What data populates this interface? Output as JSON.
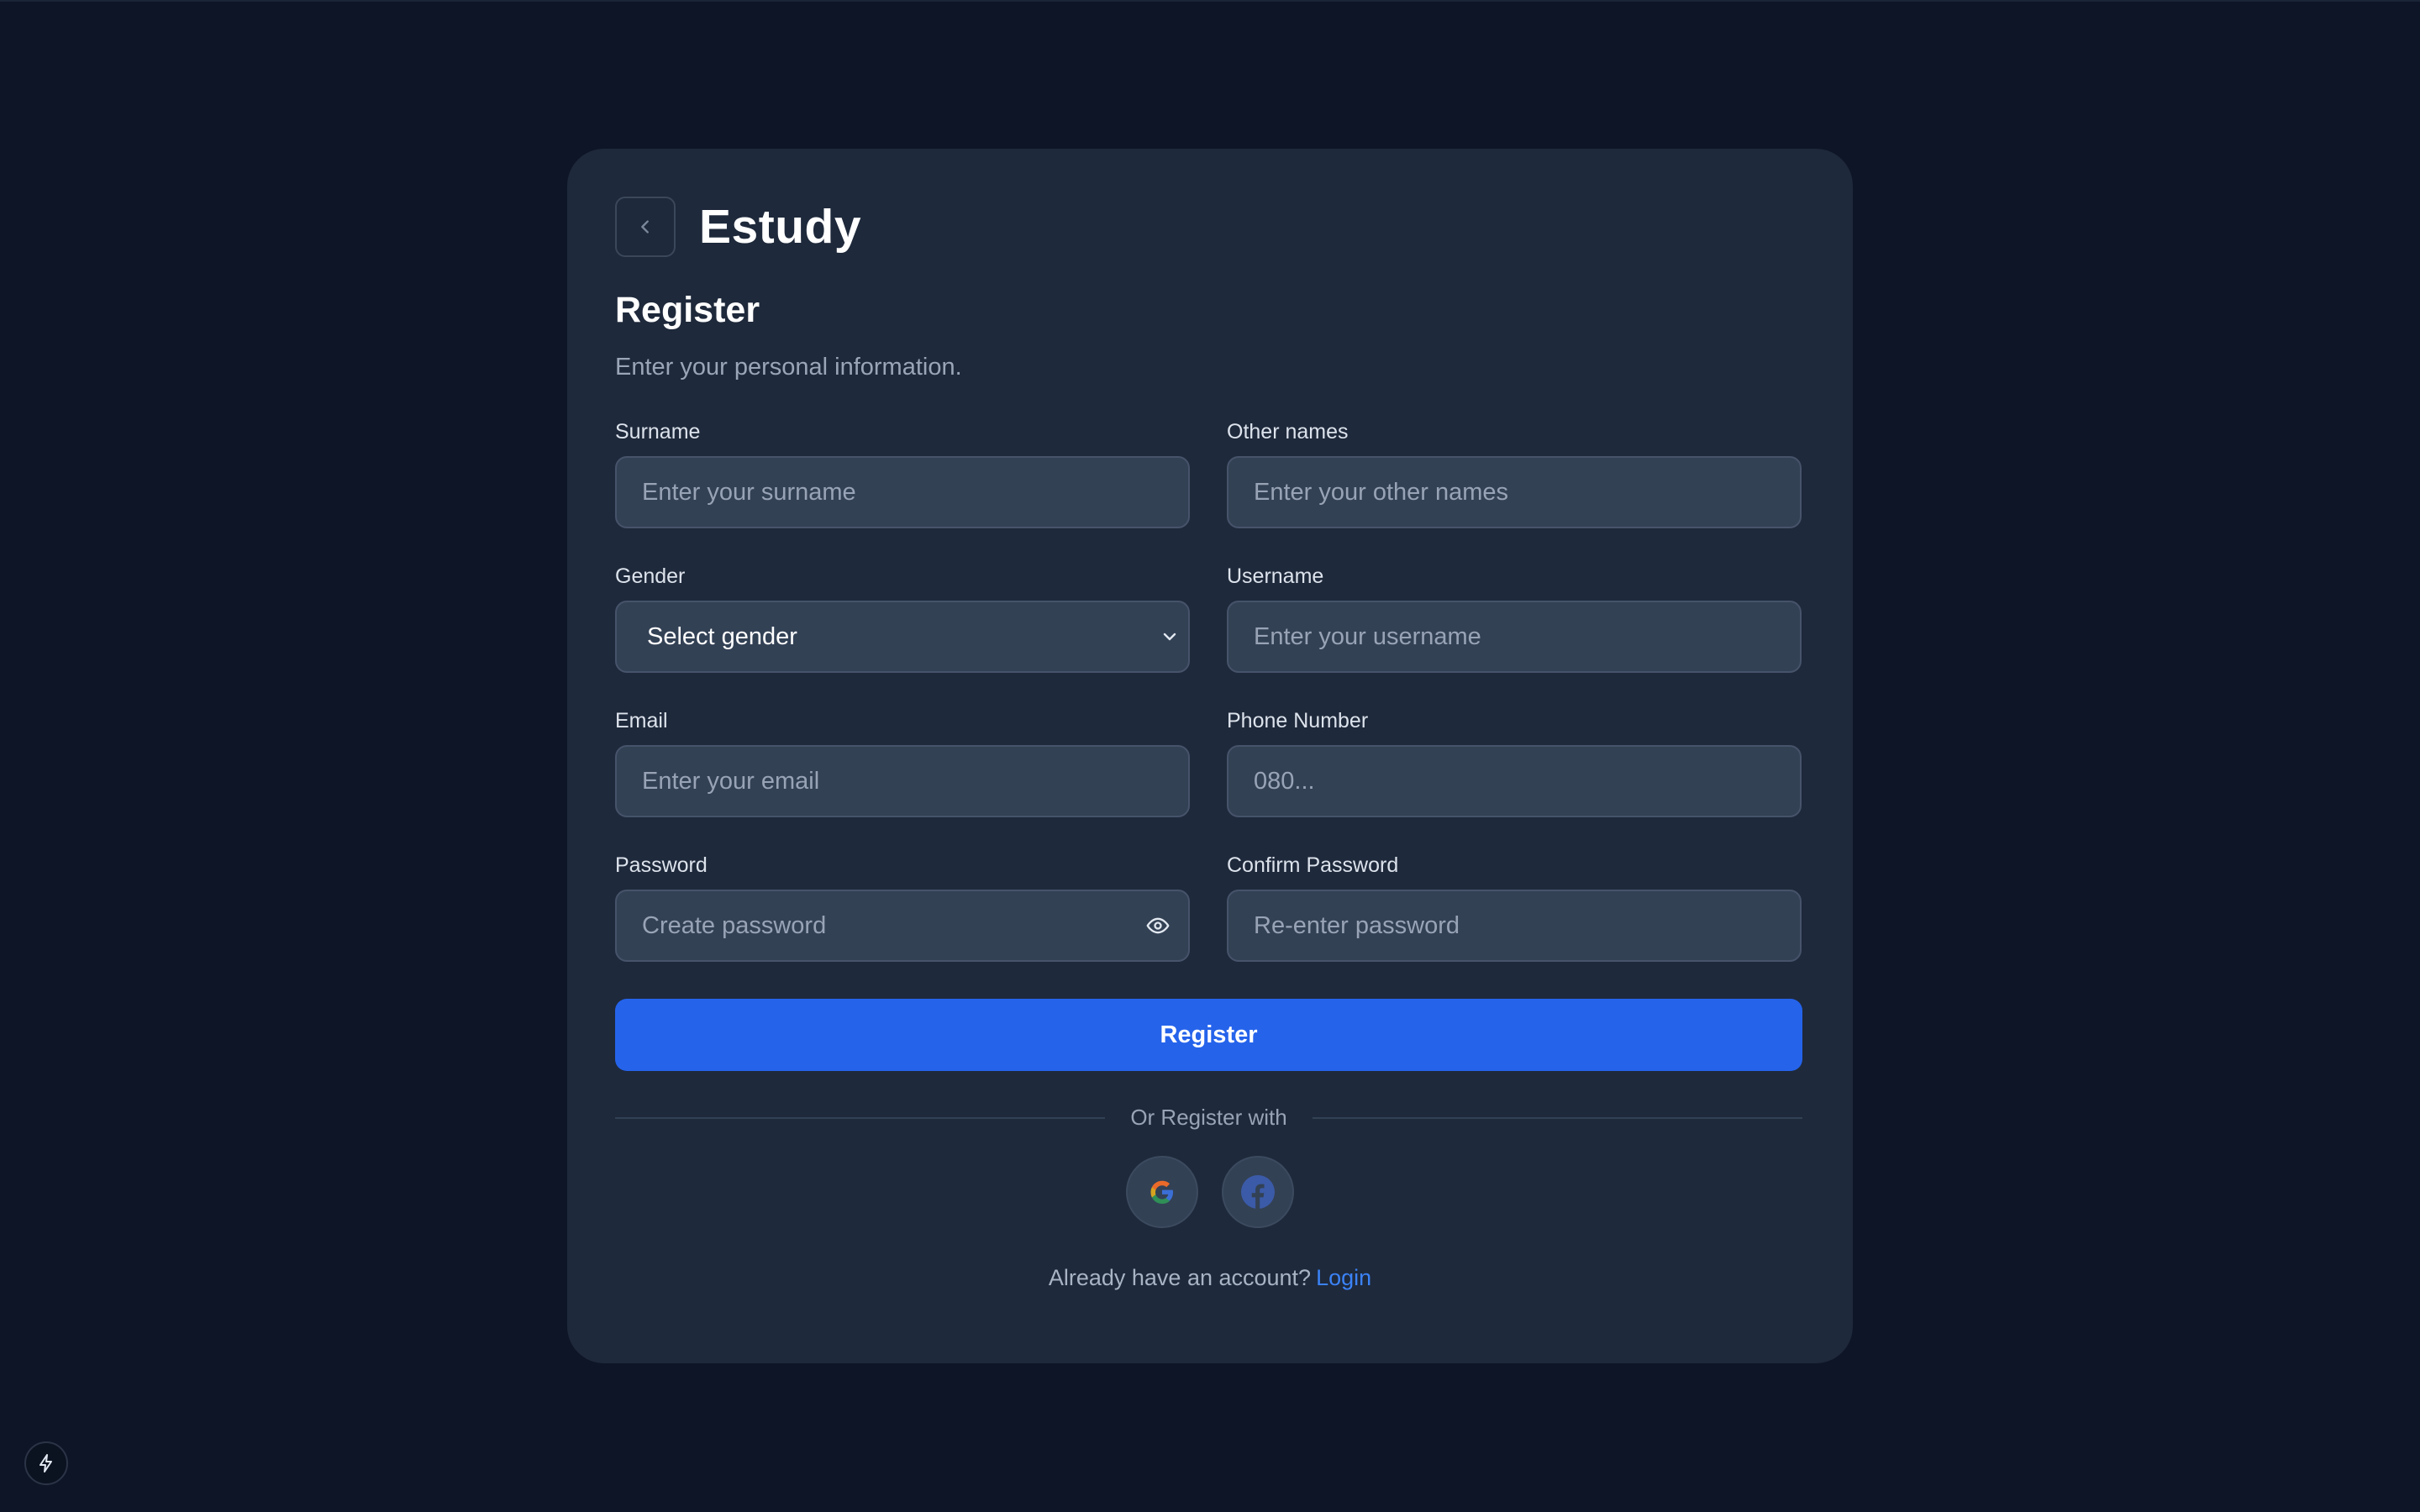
{
  "app": {
    "brand": "Estudy"
  },
  "page": {
    "title": "Register",
    "subtitle": "Enter your personal information."
  },
  "form": {
    "surname": {
      "label": "Surname",
      "placeholder": "Enter your surname",
      "value": ""
    },
    "other_names": {
      "label": "Other names",
      "placeholder": "Enter your other names",
      "value": ""
    },
    "gender": {
      "label": "Gender",
      "selected": "Select gender"
    },
    "username": {
      "label": "Username",
      "placeholder": "Enter your username",
      "value": ""
    },
    "email": {
      "label": "Email",
      "placeholder": "Enter your email",
      "value": ""
    },
    "phone": {
      "label": "Phone Number",
      "placeholder": "080...",
      "value": ""
    },
    "password": {
      "label": "Password",
      "placeholder": "Create password",
      "value": ""
    },
    "confirm_password": {
      "label": "Confirm Password",
      "placeholder": "Re-enter password",
      "value": ""
    },
    "submit_label": "Register"
  },
  "social": {
    "divider_text": "Or Register with",
    "providers": [
      {
        "name": "google",
        "icon": "google-icon"
      },
      {
        "name": "facebook",
        "icon": "facebook-icon"
      }
    ]
  },
  "footer": {
    "prompt": "Already have an account?",
    "login_label": "Login"
  },
  "icons": {
    "back": "chevron-left-icon",
    "password_toggle": "eye-icon",
    "select": "chevron-down-icon",
    "dev_indicator": "lightning-bolt-icon"
  },
  "colors": {
    "background": "#0d1526",
    "card": "#1e293b",
    "input": "#334155",
    "accent": "#2563eb",
    "link": "#3b82f6"
  }
}
